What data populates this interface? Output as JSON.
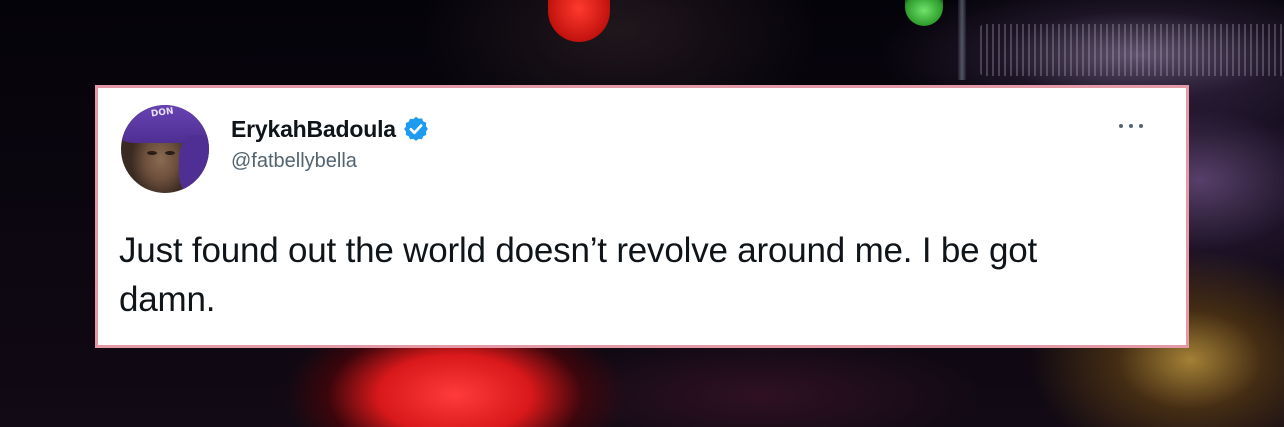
{
  "tweet": {
    "display_name": "ErykahBadoula",
    "handle": "@fatbellybella",
    "text": "Just found out the world doesn’t revolve around me. I be got damn.",
    "verified": true,
    "avatar_hat_text": "DON"
  },
  "colors": {
    "card_border": "#e39aa6",
    "verified_blue": "#1d9bf0",
    "text_primary": "#0f1419",
    "text_secondary": "#536471"
  },
  "icons": {
    "verified": "verified-badge-icon",
    "more": "more-options-icon"
  }
}
